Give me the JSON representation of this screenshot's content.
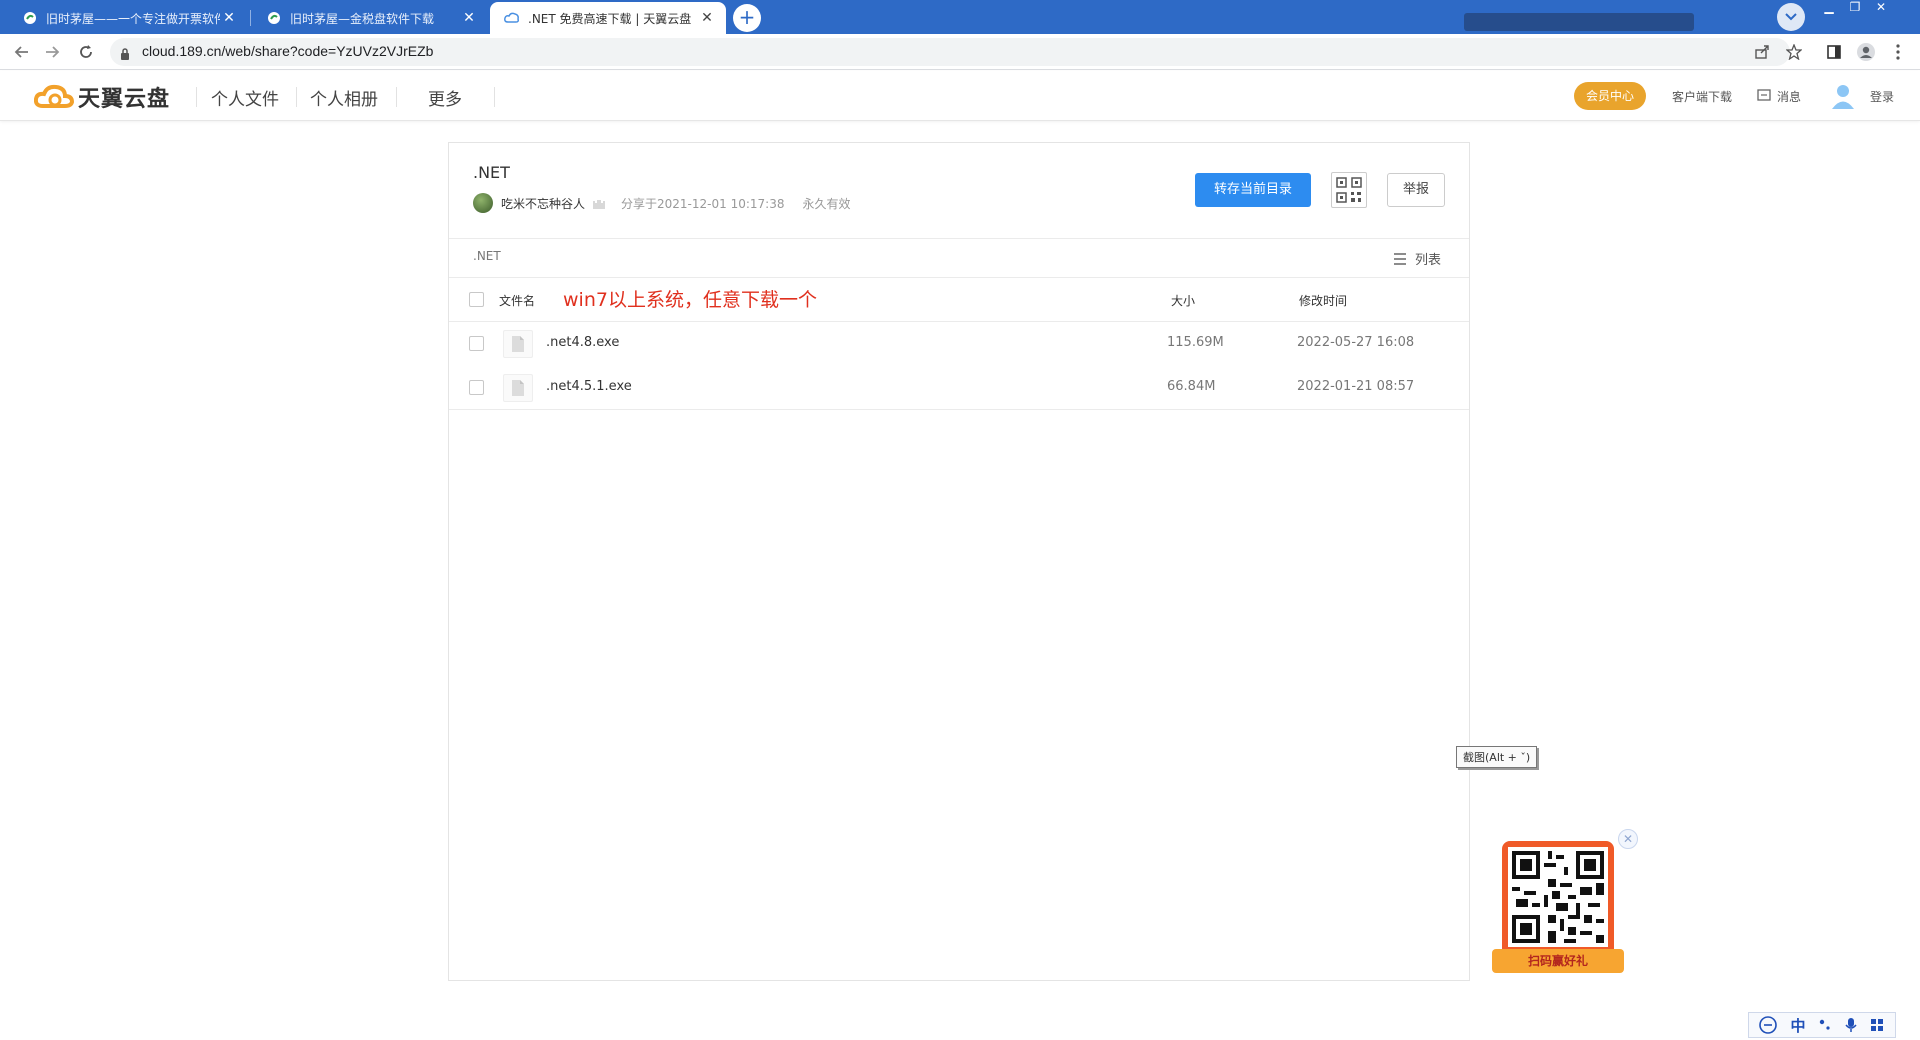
{
  "browser": {
    "tabs": [
      {
        "title": "旧时茅屋——一个专注做开票软件",
        "active": false
      },
      {
        "title": "旧时茅屋—金税盘软件下载",
        "active": false
      },
      {
        "title": ".NET 免费高速下载 | 天翼云盘 ",
        "active": true
      }
    ],
    "url": "cloud.189.cn/web/share?code=YzUVz2VJrEZb"
  },
  "site": {
    "logo_text": "天翼云盘",
    "nav": [
      "个人文件",
      "个人相册",
      "更多"
    ],
    "vip_label": "会员中心",
    "client_download": "客户端下载",
    "messages": "消息",
    "login": "登录"
  },
  "share": {
    "title": ".NET",
    "owner": "吃米不忘种谷人",
    "shared_at": "分享于2021-12-01 10:17:38",
    "validity": "永久有效",
    "save_button": "转存当前目录",
    "report_button": "举报",
    "breadcrumb": ".NET",
    "view_label": "列表",
    "columns": {
      "name": "文件名",
      "size": "大小",
      "modified": "修改时间"
    },
    "annotation": "win7以上系统，任意下载一个",
    "files": [
      {
        "name": ".net4.8.exe",
        "size": "115.69M",
        "modified": "2022-05-27 16:08"
      },
      {
        "name": ".net4.5.1.exe",
        "size": "66.84M",
        "modified": "2022-01-21 08:57"
      }
    ]
  },
  "overlay": {
    "tooltip": "截图(Alt + ˇ)",
    "qr_caption": "扫码赢好礼",
    "ime_lang": "中"
  },
  "colors": {
    "chrome_blue": "#2e6ac6",
    "primary": "#2d8cf0",
    "vip": "#e9a42c",
    "annotation": "#e0301e"
  }
}
